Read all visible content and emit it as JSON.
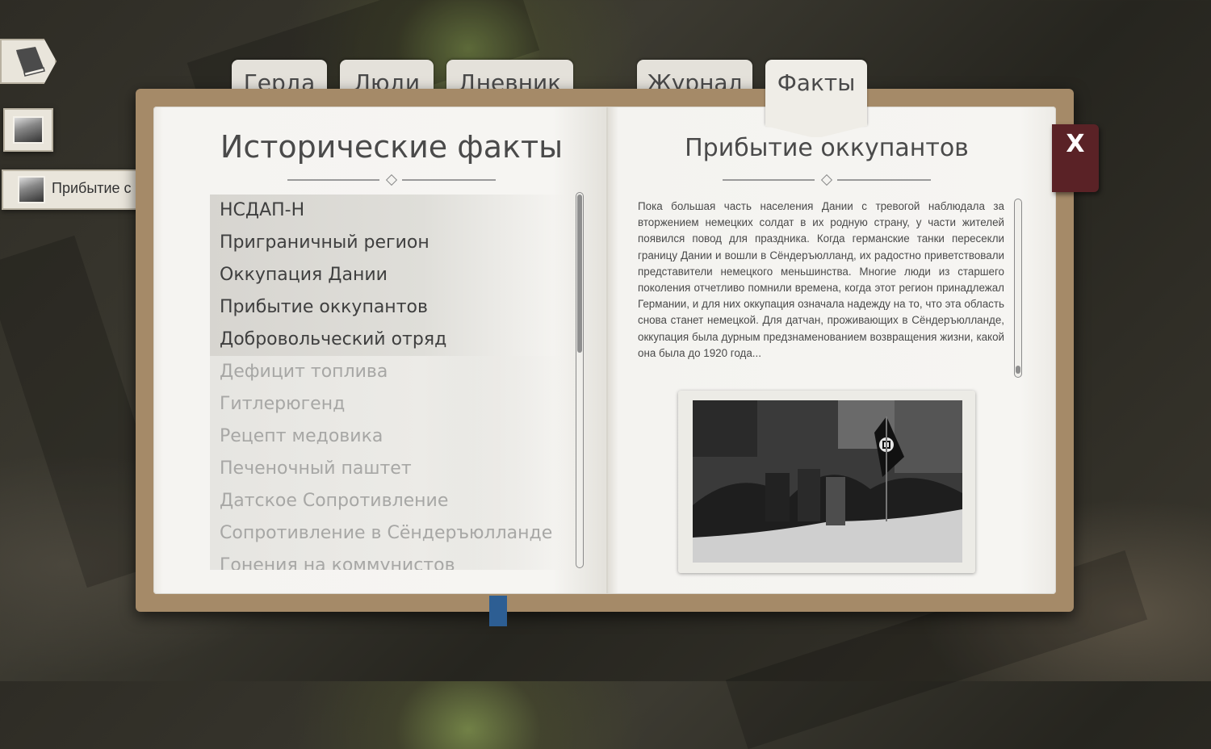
{
  "tabs": [
    {
      "label": "Герда",
      "active": false
    },
    {
      "label": "Люди",
      "active": false
    },
    {
      "label": "Дневник",
      "active": false
    },
    {
      "label": "Журнал",
      "active": false
    },
    {
      "label": "Факты",
      "active": true
    }
  ],
  "side": {
    "entry_label": "Прибытие с"
  },
  "left_page": {
    "title": "Исторические факты",
    "items": [
      {
        "label": "НСДАП-Н",
        "unlocked": true
      },
      {
        "label": "Приграничный регион",
        "unlocked": true
      },
      {
        "label": "Оккупация Дании",
        "unlocked": true
      },
      {
        "label": "Прибытие оккупантов",
        "unlocked": true
      },
      {
        "label": "Добровольческий отряд",
        "unlocked": true
      },
      {
        "label": "Дефицит топлива",
        "unlocked": false
      },
      {
        "label": "Гитлерюгенд",
        "unlocked": false
      },
      {
        "label": "Рецепт медовика",
        "unlocked": false
      },
      {
        "label": "Печеночный паштет",
        "unlocked": false
      },
      {
        "label": "Датское Сопротивление",
        "unlocked": false
      },
      {
        "label": "Сопротивление в Сёндеръюлланде",
        "unlocked": false
      },
      {
        "label": "Гонения на коммунистов",
        "unlocked": false
      }
    ]
  },
  "right_page": {
    "title": "Прибытие оккупантов",
    "body": "Пока большая часть населения Дании с тревогой наблюдала за вторжением немецких солдат в их родную страну, у части жителей появился повод для праздника. Когда германские танки пересекли границу Дании и вошли в Сёндеръюлланд, их радостно приветствовали представители немецкого меньшинства. Многие люди из старшего поколения отчетливо помнили времена, когда этот регион принадлежал Германии, и для них оккупация означала надежду на то, что эта область снова станет немецкой. Для датчан, проживающих в Сёндеръюлланде, оккупация была дурным предзнаменованием возвращения жизни, какой она была до 1920 года..."
  },
  "close_label": "X",
  "colors": {
    "cover": "#a58a68",
    "page": "#f3f2ef",
    "close_button": "#5a2226",
    "bookmark": "#2d5e93",
    "text": "#4a4a4a",
    "locked_text": "#a7a7a5"
  }
}
